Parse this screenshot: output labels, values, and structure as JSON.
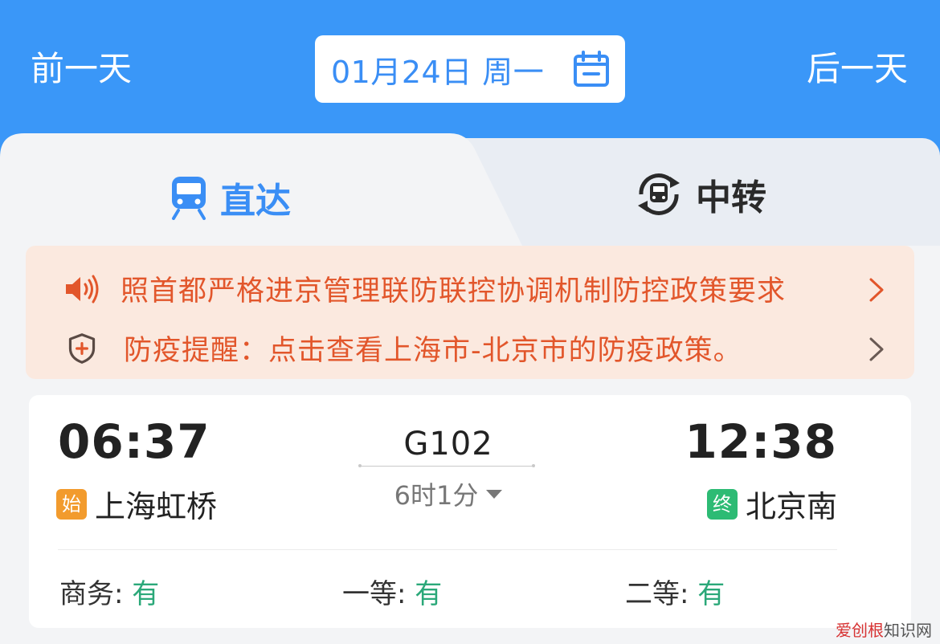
{
  "header": {
    "prev_day": "前一天",
    "next_day": "后一天",
    "date": "01月24日  周一",
    "date_icon": "calendar-icon"
  },
  "tabs": [
    {
      "label": "直达",
      "icon": "train-icon",
      "active": true
    },
    {
      "label": "中转",
      "icon": "transfer-train-icon",
      "active": false
    }
  ],
  "notices": [
    {
      "icon": "speaker-icon",
      "text": "照首都严格进京管理联防联控协调机制防控政策要求"
    },
    {
      "icon": "shield-plus-icon",
      "text": "防疫提醒：点击查看上海市-北京市的防疫政策。"
    }
  ],
  "train": {
    "departure_time": "06:37",
    "departure_badge": "始",
    "departure_station": "上海虹桥",
    "arrival_time": "12:38",
    "arrival_badge": "终",
    "arrival_station": "北京南",
    "number": "G102",
    "duration": "6时1分",
    "seats": [
      {
        "label": "商务:",
        "status": "有"
      },
      {
        "label": "一等:",
        "status": "有"
      },
      {
        "label": "二等:",
        "status": "有"
      }
    ]
  },
  "watermark": {
    "part1": "爱创根",
    "part2": "知识网"
  },
  "colors": {
    "primary_blue": "#3a97f8",
    "notice_text": "#e2562b",
    "available_green": "#2ba879"
  }
}
